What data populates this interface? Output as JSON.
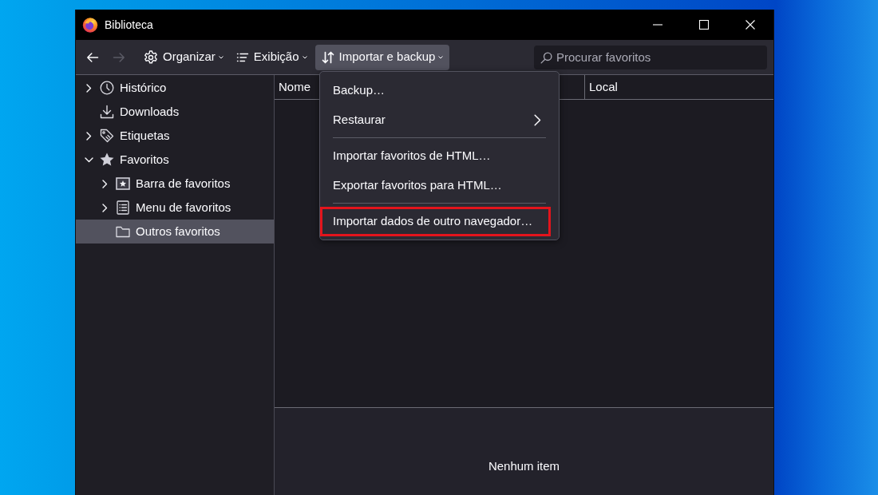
{
  "window": {
    "title": "Biblioteca"
  },
  "toolbar": {
    "back": {
      "disabled": false
    },
    "forward": {
      "disabled": true
    },
    "buttons": [
      {
        "label": "Organizar",
        "expanded": false
      },
      {
        "label": "Exibição",
        "expanded": false
      },
      {
        "label": "Importar e backup",
        "expanded": true
      }
    ],
    "search": {
      "placeholder": "Procurar favoritos"
    }
  },
  "dropdown_menu": {
    "items": [
      {
        "kind": "action",
        "label": "Backup…",
        "highlighted": false
      },
      {
        "kind": "submenu",
        "label": "Restaurar",
        "highlighted": false
      },
      {
        "kind": "separator"
      },
      {
        "kind": "action",
        "label": "Importar favoritos de HTML…",
        "highlighted": false
      },
      {
        "kind": "action",
        "label": "Exportar favoritos para HTML…",
        "highlighted": false
      },
      {
        "kind": "separator"
      },
      {
        "kind": "action",
        "label": "Importar dados de outro navegador…",
        "highlighted": true
      }
    ]
  },
  "sidebar": {
    "items": [
      {
        "kind": "history",
        "label": "Histórico",
        "expanded": false,
        "selected": false
      },
      {
        "kind": "downloads",
        "label": "Downloads",
        "selected": false
      },
      {
        "kind": "tags",
        "label": "Etiquetas",
        "expanded": false,
        "selected": false
      },
      {
        "kind": "bookmarks",
        "label": "Favoritos",
        "expanded": true,
        "selected": false,
        "children": [
          {
            "kind": "toolbar",
            "label": "Barra de favoritos",
            "expanded": false,
            "selected": false
          },
          {
            "kind": "menu",
            "label": "Menu de favoritos",
            "expanded": false,
            "selected": false
          },
          {
            "kind": "folder",
            "label": "Outros favoritos",
            "selected": true
          }
        ]
      }
    ]
  },
  "table": {
    "columns": [
      {
        "label": "Nome"
      },
      {
        "label": "Local"
      }
    ]
  },
  "details_pane": {
    "message": "Nenhum item"
  }
}
